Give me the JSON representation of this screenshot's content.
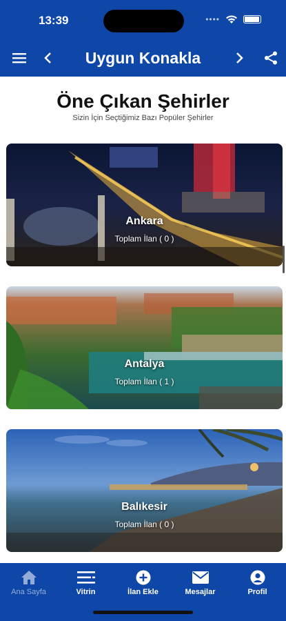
{
  "status": {
    "time": "13:39"
  },
  "header": {
    "title": "Uygun Konakla"
  },
  "section": {
    "title": "Öne Çıkan Şehirler",
    "subtitle": "Sizin İçin Seçtiğimiz Bazı Popüler Şehirler"
  },
  "cities": [
    {
      "name": "Ankara",
      "count": "Toplam İlan ( 0 )"
    },
    {
      "name": "Antalya",
      "count": "Toplam İlan ( 1 )"
    },
    {
      "name": "Balıkesir",
      "count": "Toplam İlan ( 0 )"
    }
  ],
  "tabs": [
    {
      "label": "Ana Sayfa",
      "icon": "home-icon"
    },
    {
      "label": "Vitrin",
      "icon": "vitrin-icon"
    },
    {
      "label": "İlan Ekle",
      "icon": "add-circle-icon"
    },
    {
      "label": "Mesajlar",
      "icon": "mail-icon"
    },
    {
      "label": "Profil",
      "icon": "profile-icon"
    }
  ]
}
